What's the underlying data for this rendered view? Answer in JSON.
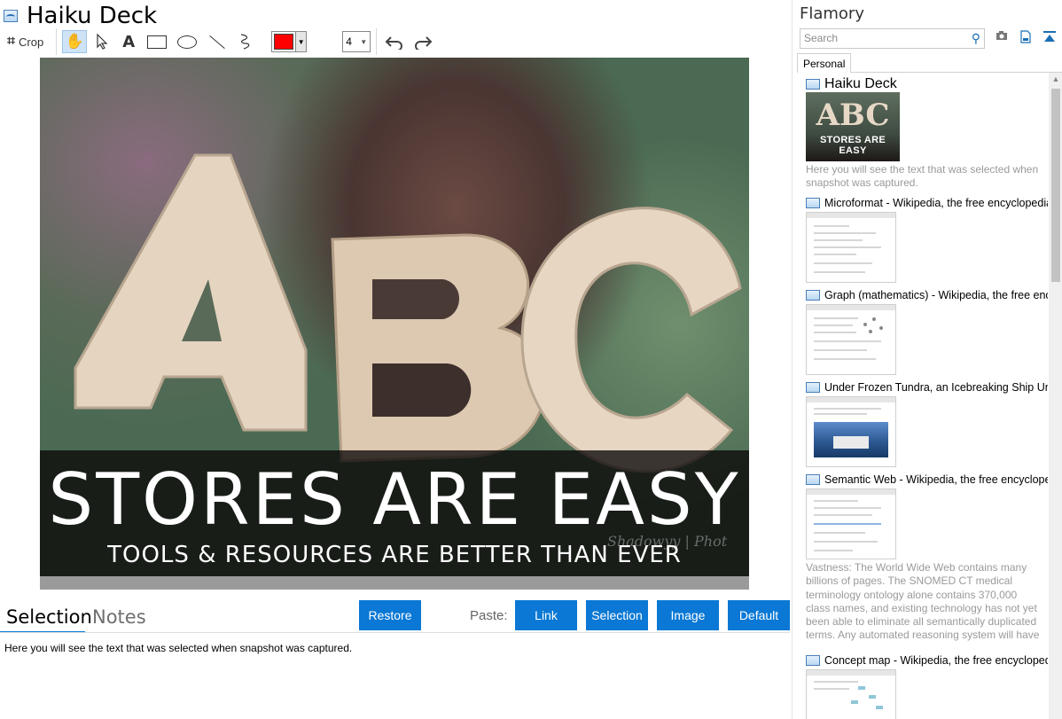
{
  "window": {
    "title": "Haiku Deck"
  },
  "toolbar": {
    "crop_label": "Crop",
    "line_width": "4",
    "color": "#ff0000",
    "tools": [
      "hand-icon",
      "pointer-icon",
      "text-icon",
      "rectangle-icon",
      "ellipse-icon",
      "line-icon",
      "freehand-icon",
      "undo-icon",
      "redo-icon"
    ]
  },
  "photo": {
    "headline": "STORES ARE EASY",
    "subline": "TOOLS & RESOURCES ARE BETTER THAN EVER",
    "watermark": "Shadowyy | Phot"
  },
  "bottom": {
    "tab_selection": "Selection",
    "tab_notes": "Notes",
    "restore": "Restore",
    "paste_label": "Paste:",
    "link": "Link",
    "selection": "Selection",
    "image": "Image",
    "default": "Default",
    "selected_text": "Here you will see the text that was selected when snapshot was captured."
  },
  "sidebar": {
    "app_name": "Flamory",
    "search_placeholder": "Search",
    "tab_personal": "Personal",
    "items": [
      {
        "title": "Haiku Deck",
        "desc": "Here you will see the text that was selected when snapshot was captured."
      },
      {
        "title": "Microformat - Wikipedia, the free encyclopedia"
      },
      {
        "title": "Graph (mathematics) - Wikipedia, the free encyclopedia"
      },
      {
        "title": "Under Frozen Tundra, an Icebreaking Ship Uncovers"
      },
      {
        "title": "Semantic Web - Wikipedia, the free encyclopedia",
        "desc": "Vastness: The World Wide Web contains many billions of pages. The SNOMED CT medical terminology ontology alone contains 370,000 class names, and existing technology has not yet been able to eliminate all semantically duplicated terms. Any automated reasoning system will have to deal with truly huge inputs."
      },
      {
        "title": "Concept map - Wikipedia, the free encyclopedia"
      }
    ]
  },
  "colors": {
    "accent": "#0a78d4",
    "pen": "#ff0000"
  }
}
